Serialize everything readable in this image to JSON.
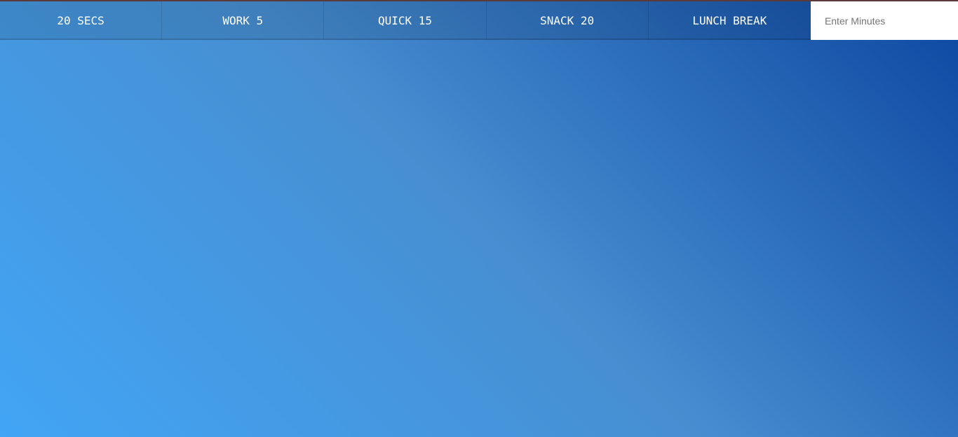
{
  "timer_buttons": [
    {
      "label": "20 SECS"
    },
    {
      "label": "WORK 5"
    },
    {
      "label": "QUICK 15"
    },
    {
      "label": "SNACK 20"
    },
    {
      "label": "LUNCH BREAK"
    }
  ],
  "custom_minutes": {
    "placeholder": "Enter Minutes",
    "value": ""
  },
  "colors": {
    "gradient_start": "#42a5f5",
    "gradient_mid": "#478ed1",
    "gradient_end": "#0d47a1",
    "button_text": "#ffffff",
    "input_background": "#ffffff"
  }
}
